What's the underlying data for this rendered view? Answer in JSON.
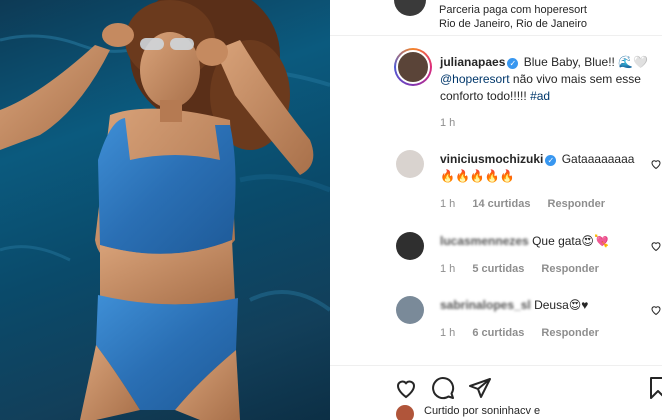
{
  "post": {
    "partner_text": "Parceria paga com hoperesort",
    "location": "Rio de Janeiro, Rio de Janeiro"
  },
  "caption": {
    "username": "julianapaes",
    "text_1": "Blue Baby, Blue!! 🌊🤍",
    "mention": "@hoperesort",
    "text_2": "não vivo mais sem esse conforto todo!!!!!",
    "hashtag": "#ad",
    "time": "1 h"
  },
  "comments": [
    {
      "username": "viniciusmochizuki",
      "text": "Gataaaaaaaa 🔥🔥🔥🔥🔥",
      "time": "1 h",
      "likes": "14 curtidas",
      "reply": "Responder"
    },
    {
      "username": "lucasmennezes",
      "text": "Que gata😍💘",
      "time": "1 h",
      "likes": "5 curtidas",
      "reply": "Responder"
    },
    {
      "username": "sabrinalopes_sl",
      "text": "Deusa😍♥",
      "time": "1 h",
      "likes": "6 curtidas",
      "reply": "Responder"
    }
  ],
  "footer": {
    "liked_by": "Curtido por soninhacv e"
  },
  "icons": [
    "verified-icon",
    "heart-icon",
    "comment-icon",
    "share-icon"
  ],
  "colors": {
    "link": "#00376b",
    "verified": "#3897f0",
    "muted": "#8e8e8e"
  }
}
